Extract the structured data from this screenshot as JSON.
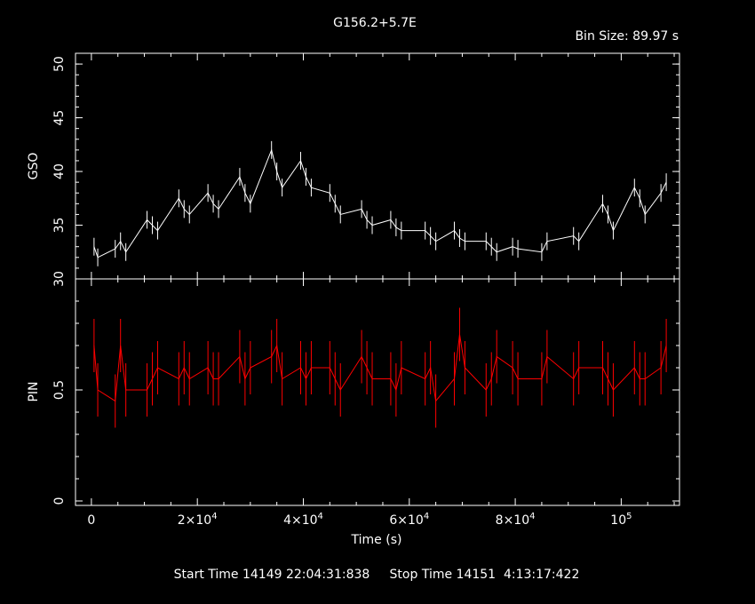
{
  "chart_data": {
    "type": "line",
    "title": "G156.2+5.7E",
    "bin_size_label": "Bin Size:  89.97  s",
    "footer": "Start Time 14149 22:04:31:838     Stop Time 14151  4:13:17:422",
    "xlabel": "Time (s)",
    "xlim": [
      -3000,
      111000
    ],
    "x_ticks": [
      {
        "value": 0,
        "base": "0",
        "exp": ""
      },
      {
        "value": 20000,
        "base": "2×10",
        "exp": "4"
      },
      {
        "value": 40000,
        "base": "4×10",
        "exp": "4"
      },
      {
        "value": 60000,
        "base": "6×10",
        "exp": "4"
      },
      {
        "value": 80000,
        "base": "8×10",
        "exp": "4"
      },
      {
        "value": 100000,
        "base": "10",
        "exp": "5"
      }
    ],
    "panels": [
      {
        "name": "GSO",
        "ylabel": "GSO",
        "color": "#ffffff",
        "ylim": [
          30,
          51
        ],
        "y_ticks": [
          30,
          35,
          40,
          45,
          50
        ],
        "series": [
          {
            "name": "GSO",
            "x": [
              500,
              1200,
              4500,
              5500,
              6500,
              10500,
              11500,
              12500,
              16500,
              17500,
              18500,
              22000,
              23000,
              24000,
              28000,
              29000,
              30000,
              34000,
              35000,
              36000,
              39500,
              40500,
              41500,
              45000,
              46000,
              47000,
              51000,
              52000,
              53000,
              56500,
              57500,
              58500,
              63000,
              64000,
              65000,
              68500,
              69500,
              70500,
              74500,
              75500,
              76500,
              79500,
              80500,
              85000,
              86000,
              91000,
              92000,
              96500,
              97500,
              98500,
              102500,
              103500,
              104500,
              107500,
              108500
            ],
            "y": [
              33.0,
              32.0,
              32.8,
              33.5,
              32.5,
              35.5,
              35.0,
              34.5,
              37.5,
              36.5,
              36.0,
              38.0,
              37.0,
              36.5,
              39.5,
              38.0,
              37.0,
              42.0,
              40.0,
              38.5,
              41.0,
              39.5,
              38.5,
              38.0,
              37.0,
              36.0,
              36.5,
              35.5,
              35.0,
              35.5,
              34.8,
              34.5,
              34.5,
              34.0,
              33.5,
              34.5,
              33.8,
              33.5,
              33.5,
              33.0,
              32.5,
              33.0,
              32.8,
              32.5,
              33.5,
              34.0,
              33.5,
              37.0,
              36.0,
              34.5,
              38.5,
              37.5,
              36.0,
              38.0,
              39.0
            ]
          }
        ]
      },
      {
        "name": "PIN",
        "ylabel": "PIN",
        "color": "#ff0000",
        "ylim": [
          -0.02,
          1.0
        ],
        "y_ticks": [
          0,
          0.5
        ],
        "series": [
          {
            "name": "PIN",
            "x": [
              500,
              1200,
              4500,
              5500,
              6500,
              10500,
              11500,
              12500,
              16500,
              17500,
              18500,
              22000,
              23000,
              24000,
              28000,
              29000,
              30000,
              34000,
              35000,
              36000,
              39500,
              40500,
              41500,
              45000,
              46000,
              47000,
              51000,
              52000,
              53000,
              56500,
              57500,
              58500,
              63000,
              64000,
              65000,
              68500,
              69500,
              70500,
              74500,
              75500,
              76500,
              79500,
              80500,
              85000,
              86000,
              91000,
              92000,
              96500,
              97500,
              98500,
              102500,
              103500,
              104500,
              107500,
              108500
            ],
            "y": [
              0.7,
              0.5,
              0.45,
              0.7,
              0.5,
              0.5,
              0.55,
              0.6,
              0.55,
              0.6,
              0.55,
              0.6,
              0.55,
              0.55,
              0.65,
              0.55,
              0.6,
              0.65,
              0.7,
              0.55,
              0.6,
              0.55,
              0.6,
              0.6,
              0.55,
              0.5,
              0.65,
              0.6,
              0.55,
              0.55,
              0.5,
              0.6,
              0.55,
              0.6,
              0.45,
              0.55,
              0.75,
              0.6,
              0.5,
              0.55,
              0.65,
              0.6,
              0.55,
              0.55,
              0.65,
              0.55,
              0.6,
              0.6,
              0.55,
              0.5,
              0.6,
              0.55,
              0.55,
              0.6,
              0.7
            ]
          }
        ]
      }
    ]
  }
}
